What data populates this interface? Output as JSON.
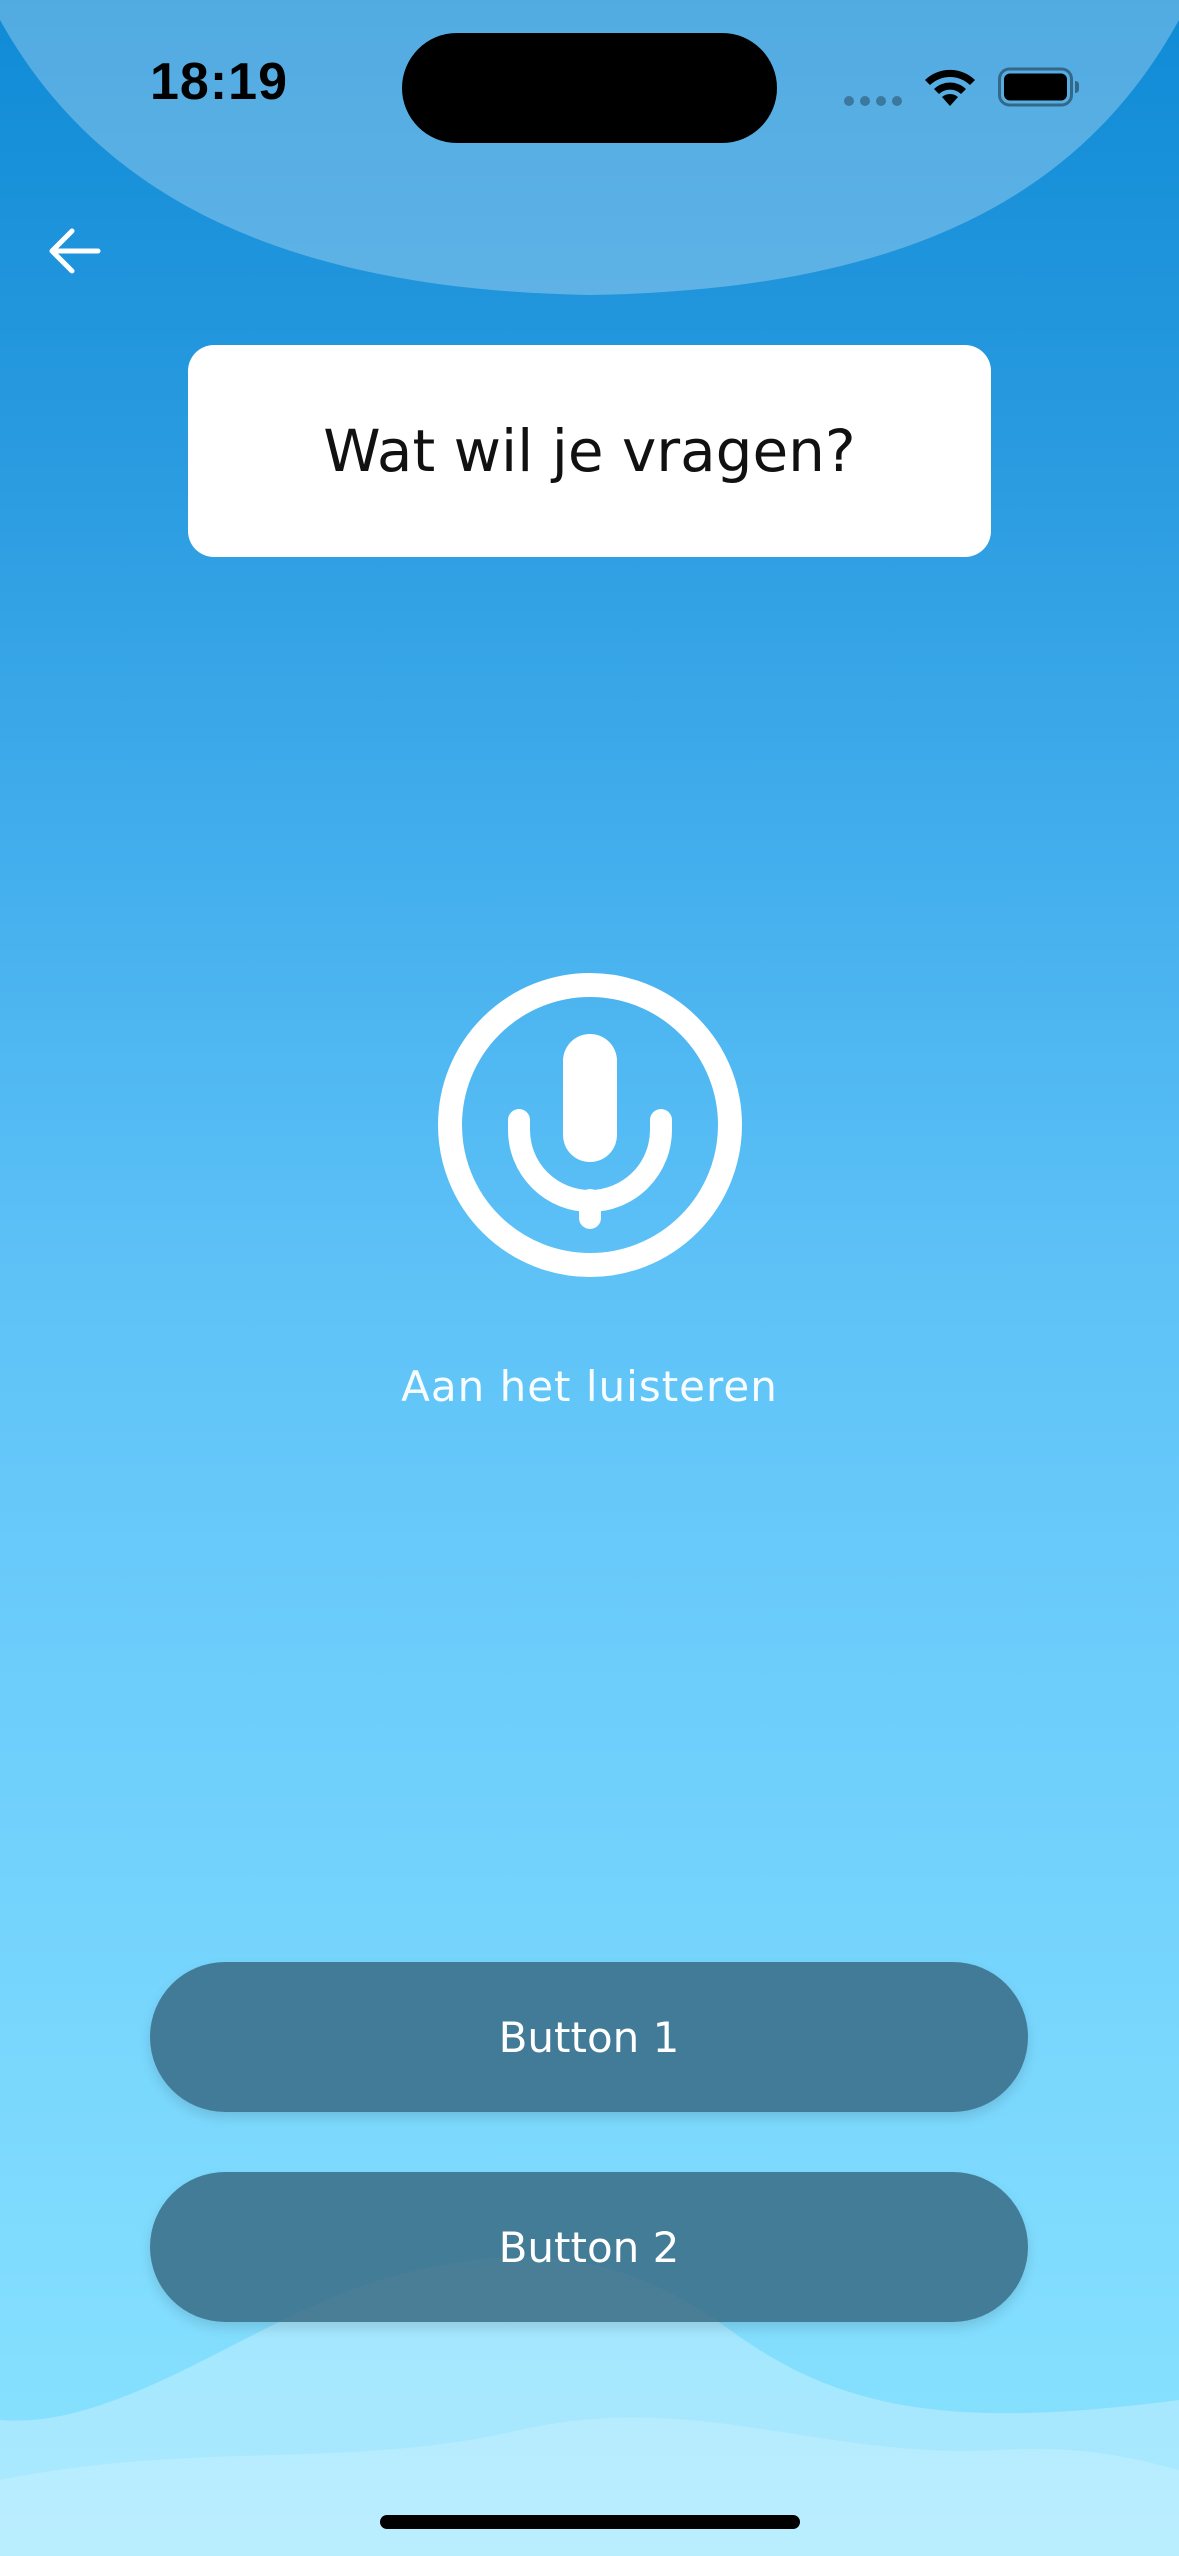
{
  "status_bar": {
    "time": "18:19"
  },
  "navigation": {
    "back_icon": "arrow-left-icon"
  },
  "prompt": {
    "text": "Wat wil je vragen?"
  },
  "microphone": {
    "icon": "microphone-icon",
    "status_label": "Aan het luisteren"
  },
  "buttons": [
    {
      "label": "Button 1"
    },
    {
      "label": "Button 2"
    }
  ],
  "colors": {
    "background_top": "#0f8bd6",
    "background_bottom": "#8ae3ff",
    "card": "#ffffff",
    "button_fill": "#366680",
    "text_on_dark": "#ffffff"
  }
}
